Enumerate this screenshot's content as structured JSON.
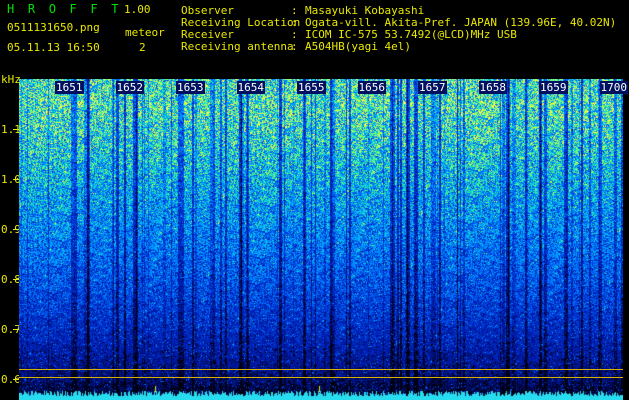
{
  "header": {
    "app_title": "H R O F F T",
    "version": "1.00",
    "filename": "0511131650.png",
    "datetime": "05.11.13 16:50",
    "meteor_label": "meteor",
    "meteor_count": "2"
  },
  "info": [
    {
      "label": "Observer",
      "value": "Masayuki Kobayashi"
    },
    {
      "label": "Receiving Location",
      "value": "Ogata-vill. Akita-Pref. JAPAN (139.96E, 40.02N)"
    },
    {
      "label": "Receiver",
      "value": "ICOM IC-575 53.7492(@LCD)MHz USB"
    },
    {
      "label": "Receiving antenna",
      "value": "A504HB(yagi 4el)"
    }
  ],
  "colon": ":",
  "spectrogram": {
    "y_axis_unit": "kHz",
    "y_ticks": [
      "1.1",
      "1.0",
      "0.9",
      "0.8",
      "0.7",
      "0.6"
    ],
    "y_range_khz": [
      0.58,
      1.2
    ],
    "minute_labels": [
      "1651",
      "1652",
      "1653",
      "1654",
      "1655",
      "1656",
      "1657",
      "1658",
      "1659",
      "1700"
    ],
    "time_range_minutes": [
      0,
      10
    ],
    "reference_lines_khz": [
      0.62,
      0.605
    ],
    "colormap": [
      "#000040",
      "#0020c0",
      "#0070ff",
      "#00c0ff",
      "#40ff80",
      "#ffff40"
    ]
  }
}
